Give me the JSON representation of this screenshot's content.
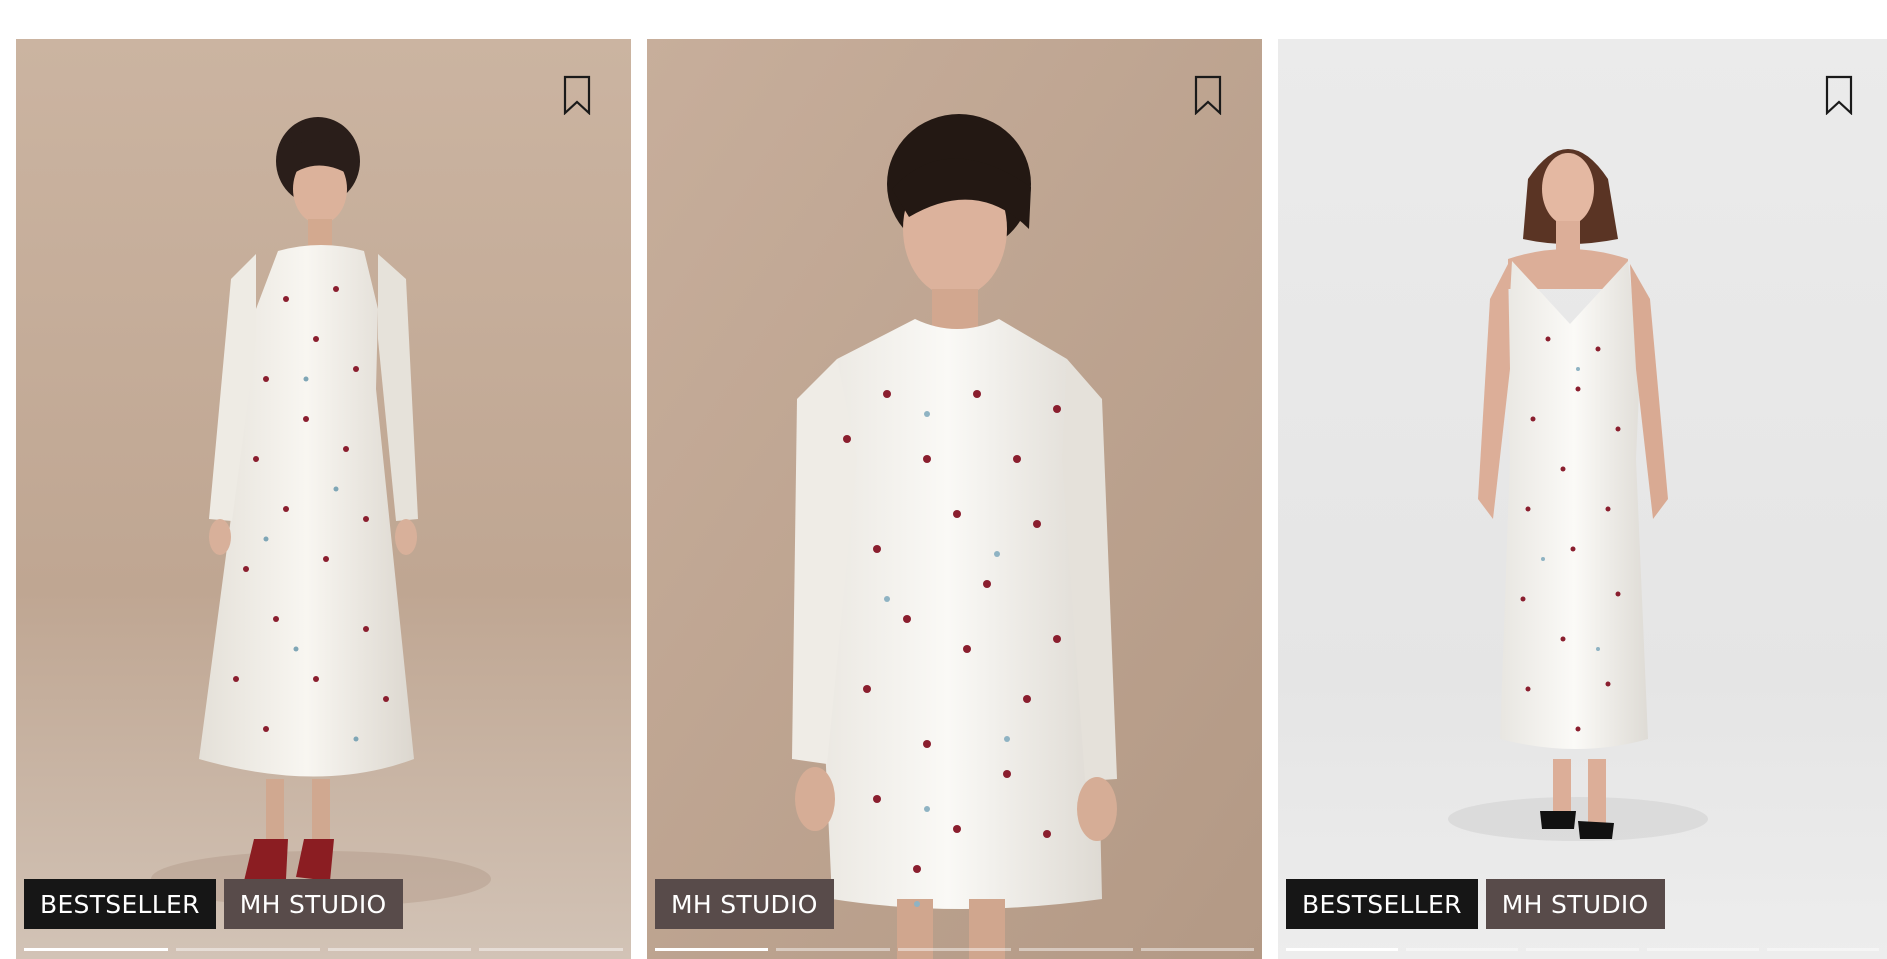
{
  "products": [
    {
      "badges": [
        {
          "type": "bestseller",
          "label": "BESTSELLER"
        },
        {
          "type": "brand",
          "label": "MH STUDIO"
        }
      ],
      "bookmark_icon": "bookmark-outline-icon",
      "image_count": 4,
      "active_image": 1
    },
    {
      "badges": [
        {
          "type": "brand",
          "label": "MH STUDIO"
        }
      ],
      "bookmark_icon": "bookmark-outline-icon",
      "image_count": 5,
      "active_image": 1
    },
    {
      "badges": [
        {
          "type": "bestseller",
          "label": "BESTSELLER"
        },
        {
          "type": "brand",
          "label": "MH STUDIO"
        }
      ],
      "bookmark_icon": "bookmark-outline-icon",
      "image_count": 5,
      "active_image": 1
    }
  ],
  "colors": {
    "bestseller_badge": "#161616",
    "brand_badge": "#584b4a",
    "badge_text": "#ffffff",
    "photo_bg_warm": "#c4ab97",
    "photo_bg_grey": "#e9e9e9"
  }
}
